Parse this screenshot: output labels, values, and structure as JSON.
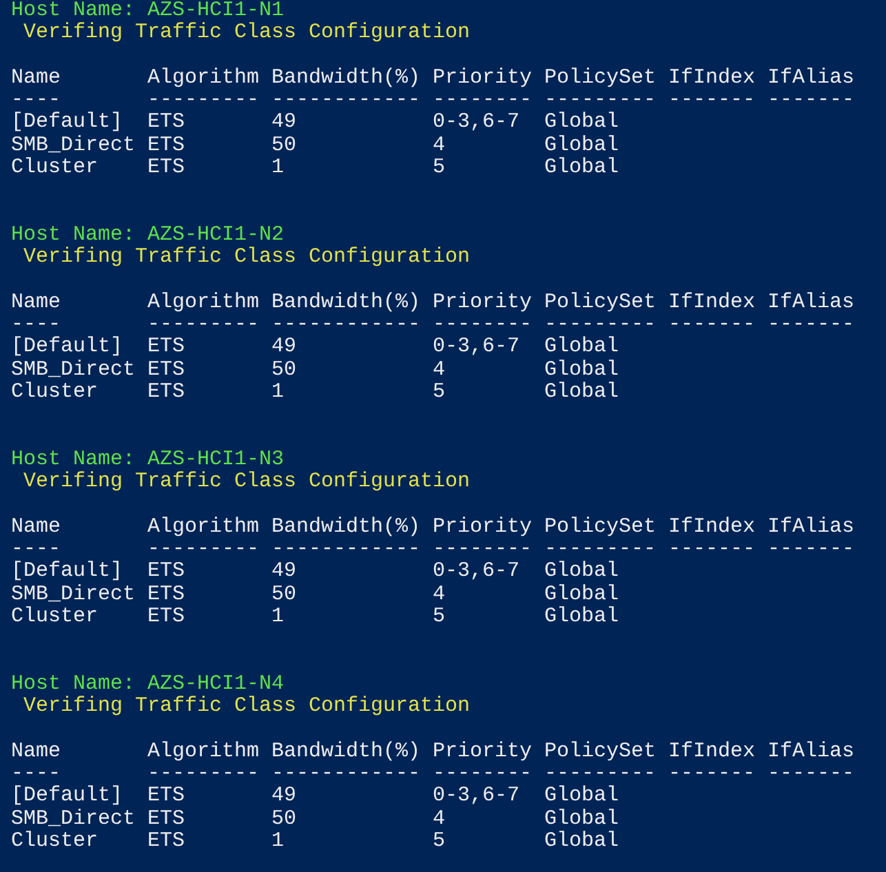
{
  "hosts": [
    {
      "host_line": "Host Name: AZS-HCI1-N1",
      "status_line": "Verifing Traffic Class Configuration",
      "columns": [
        {
          "header": "Name",
          "rule": "----"
        },
        {
          "header": "Algorithm",
          "rule": "---------"
        },
        {
          "header": "Bandwidth(%)",
          "rule": "------------"
        },
        {
          "header": "Priority",
          "rule": "--------"
        },
        {
          "header": "PolicySet",
          "rule": "---------"
        },
        {
          "header": "IfIndex",
          "rule": "-------"
        },
        {
          "header": "IfAlias",
          "rule": "-------"
        }
      ],
      "rows": [
        [
          "[Default]",
          "ETS",
          "49",
          "0-3,6-7",
          "Global"
        ],
        [
          "SMB_Direct",
          "ETS",
          "50",
          "4",
          "Global"
        ],
        [
          "Cluster",
          "ETS",
          "1",
          "5",
          "Global"
        ]
      ]
    },
    {
      "host_line": "Host Name: AZS-HCI1-N2",
      "status_line": "Verifing Traffic Class Configuration",
      "columns": [
        {
          "header": "Name",
          "rule": "----"
        },
        {
          "header": "Algorithm",
          "rule": "---------"
        },
        {
          "header": "Bandwidth(%)",
          "rule": "------------"
        },
        {
          "header": "Priority",
          "rule": "--------"
        },
        {
          "header": "PolicySet",
          "rule": "---------"
        },
        {
          "header": "IfIndex",
          "rule": "-------"
        },
        {
          "header": "IfAlias",
          "rule": "-------"
        }
      ],
      "rows": [
        [
          "[Default]",
          "ETS",
          "49",
          "0-3,6-7",
          "Global"
        ],
        [
          "SMB_Direct",
          "ETS",
          "50",
          "4",
          "Global"
        ],
        [
          "Cluster",
          "ETS",
          "1",
          "5",
          "Global"
        ]
      ]
    },
    {
      "host_line": "Host Name: AZS-HCI1-N3",
      "status_line": "Verifing Traffic Class Configuration",
      "columns": [
        {
          "header": "Name",
          "rule": "----"
        },
        {
          "header": "Algorithm",
          "rule": "---------"
        },
        {
          "header": "Bandwidth(%)",
          "rule": "------------"
        },
        {
          "header": "Priority",
          "rule": "--------"
        },
        {
          "header": "PolicySet",
          "rule": "---------"
        },
        {
          "header": "IfIndex",
          "rule": "-------"
        },
        {
          "header": "IfAlias",
          "rule": "-------"
        }
      ],
      "rows": [
        [
          "[Default]",
          "ETS",
          "49",
          "0-3,6-7",
          "Global"
        ],
        [
          "SMB_Direct",
          "ETS",
          "50",
          "4",
          "Global"
        ],
        [
          "Cluster",
          "ETS",
          "1",
          "5",
          "Global"
        ]
      ]
    },
    {
      "host_line": "Host Name: AZS-HCI1-N4",
      "status_line": "Verifing Traffic Class Configuration",
      "columns": [
        {
          "header": "Name",
          "rule": "----"
        },
        {
          "header": "Algorithm",
          "rule": "---------"
        },
        {
          "header": "Bandwidth(%)",
          "rule": "------------"
        },
        {
          "header": "Priority",
          "rule": "--------"
        },
        {
          "header": "PolicySet",
          "rule": "---------"
        },
        {
          "header": "IfIndex",
          "rule": "-------"
        },
        {
          "header": "IfAlias",
          "rule": "-------"
        }
      ],
      "rows": [
        [
          "[Default]",
          "ETS",
          "49",
          "0-3,6-7",
          "Global"
        ],
        [
          "SMB_Direct",
          "ETS",
          "50",
          "4",
          "Global"
        ],
        [
          "Cluster",
          "ETS",
          "1",
          "5",
          "Global"
        ]
      ]
    }
  ]
}
